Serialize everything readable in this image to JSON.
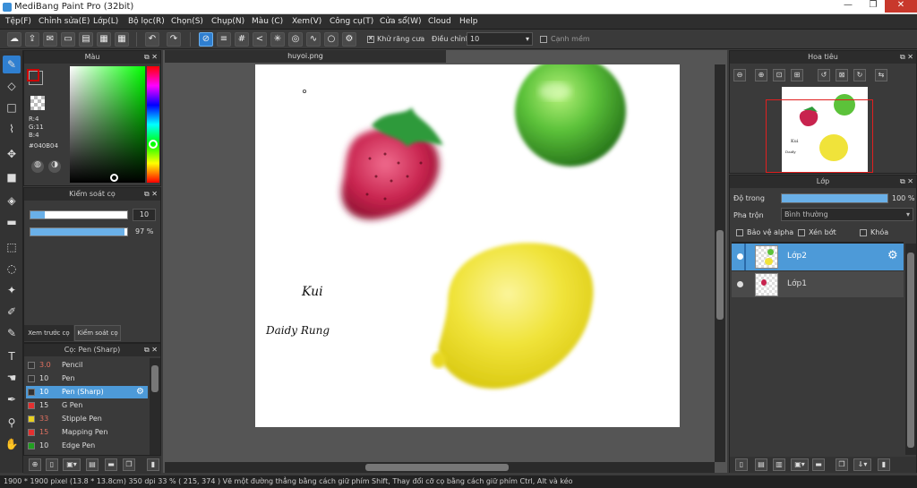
{
  "window": {
    "title": "MediBang Paint Pro (32bit)",
    "min": "—",
    "max": "❐",
    "close": "✕"
  },
  "menu": [
    "Tệp(F)",
    "Chỉnh sửa(E)",
    "Lớp(L)",
    "Bộ lọc(R)",
    "Chọn(S)",
    "Chụp(N)",
    "Màu (C)",
    "Xem(V)",
    "Công cụ(T)",
    "Cửa sổ(W)",
    "Cloud",
    "Help"
  ],
  "toolbar": {
    "antialias_label": "Khử răng cưa",
    "adjust_label": "Điều chỉnh",
    "adjust_value": "10",
    "edge_label": "Cạnh mềm"
  },
  "color_panel": {
    "title": "Màu",
    "r": "R:4",
    "g": "G:11",
    "b": "B:4",
    "hex": "#040B04",
    "fg": "#040b04",
    "bg": "#ffffff"
  },
  "brush_control": {
    "title": "Kiểm soát cọ",
    "size": "10",
    "opacity": "97 %",
    "size_frac": 0.15,
    "opacity_frac": 0.97,
    "tab_preview": "Xem trước cọ",
    "tab_control": "Kiểm soát cọ"
  },
  "brush_list": {
    "title": "Cọ: Pen (Sharp)",
    "items": [
      {
        "size": "3.0",
        "name": "Pencil",
        "color": "#333333",
        "selected": false
      },
      {
        "size": "10",
        "name": "Pen",
        "color": "#333333",
        "selected": false
      },
      {
        "size": "10",
        "name": "Pen (Sharp)",
        "color": "#333333",
        "selected": true
      },
      {
        "size": "15",
        "name": "G Pen",
        "color": "#e53030",
        "selected": false
      },
      {
        "size": "33",
        "name": "Stipple Pen",
        "color": "#e8d020",
        "selected": false
      },
      {
        "size": "15",
        "name": "Mapping Pen",
        "color": "#e53030",
        "selected": false
      },
      {
        "size": "10",
        "name": "Edge Pen",
        "color": "#20a020",
        "selected": false
      }
    ]
  },
  "document": {
    "tab": "huyoi.png",
    "signature1": "Kui",
    "signature2": "Daidy Rung"
  },
  "navigator": {
    "title": "Hoa tiêu"
  },
  "layer_panel": {
    "title": "Lớp",
    "opacity_label": "Độ trong",
    "opacity_value": "100 %",
    "opacity_frac": 1.0,
    "blend_label": "Pha trộn",
    "blend_value": "Bình thường",
    "protect_alpha": "Bảo vệ alpha",
    "clipping": "Xén bớt",
    "lock": "Khóa",
    "layers": [
      {
        "name": "Lớp2",
        "selected": true
      },
      {
        "name": "Lớp1",
        "selected": false
      }
    ]
  },
  "status": {
    "text": "1900 * 1900 pixel   (13.8 * 13.8cm)   350 dpi   33 %   ( 215, 374 )   Vẽ một đường thẳng bằng cách giữ phím Shift, Thay đổi cỡ cọ bằng cách giữ phím Ctrl, Alt và kéo"
  }
}
